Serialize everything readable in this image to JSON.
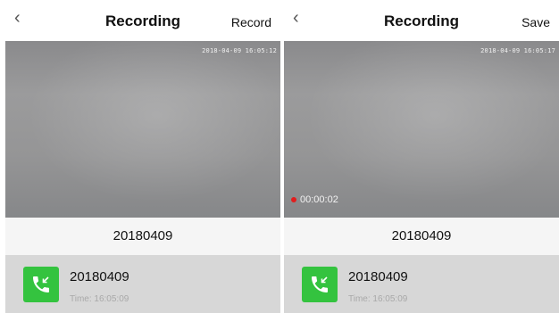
{
  "panels": [
    {
      "back_icon": "chevron-left-icon",
      "title": "Recording",
      "action_label": "Record",
      "video": {
        "timestamp": "2018-04-09 16:05:12"
      },
      "recording_name": "20180409",
      "call_entry": {
        "icon": "phone-call-icon",
        "name": "20180409",
        "time": "Time: 16:05:09"
      }
    },
    {
      "back_icon": "chevron-left-icon",
      "title": "Recording",
      "action_label": "Save",
      "video": {
        "timestamp": "2018-04-09 16:05:17",
        "rec_timer": "00:00:02"
      },
      "recording_name": "20180409",
      "call_entry": {
        "icon": "phone-call-icon",
        "name": "20180409",
        "time": "Time: 16:05:09"
      }
    }
  ],
  "colors": {
    "accent_green": "#34c33f",
    "rec_red": "#e21d1d"
  }
}
